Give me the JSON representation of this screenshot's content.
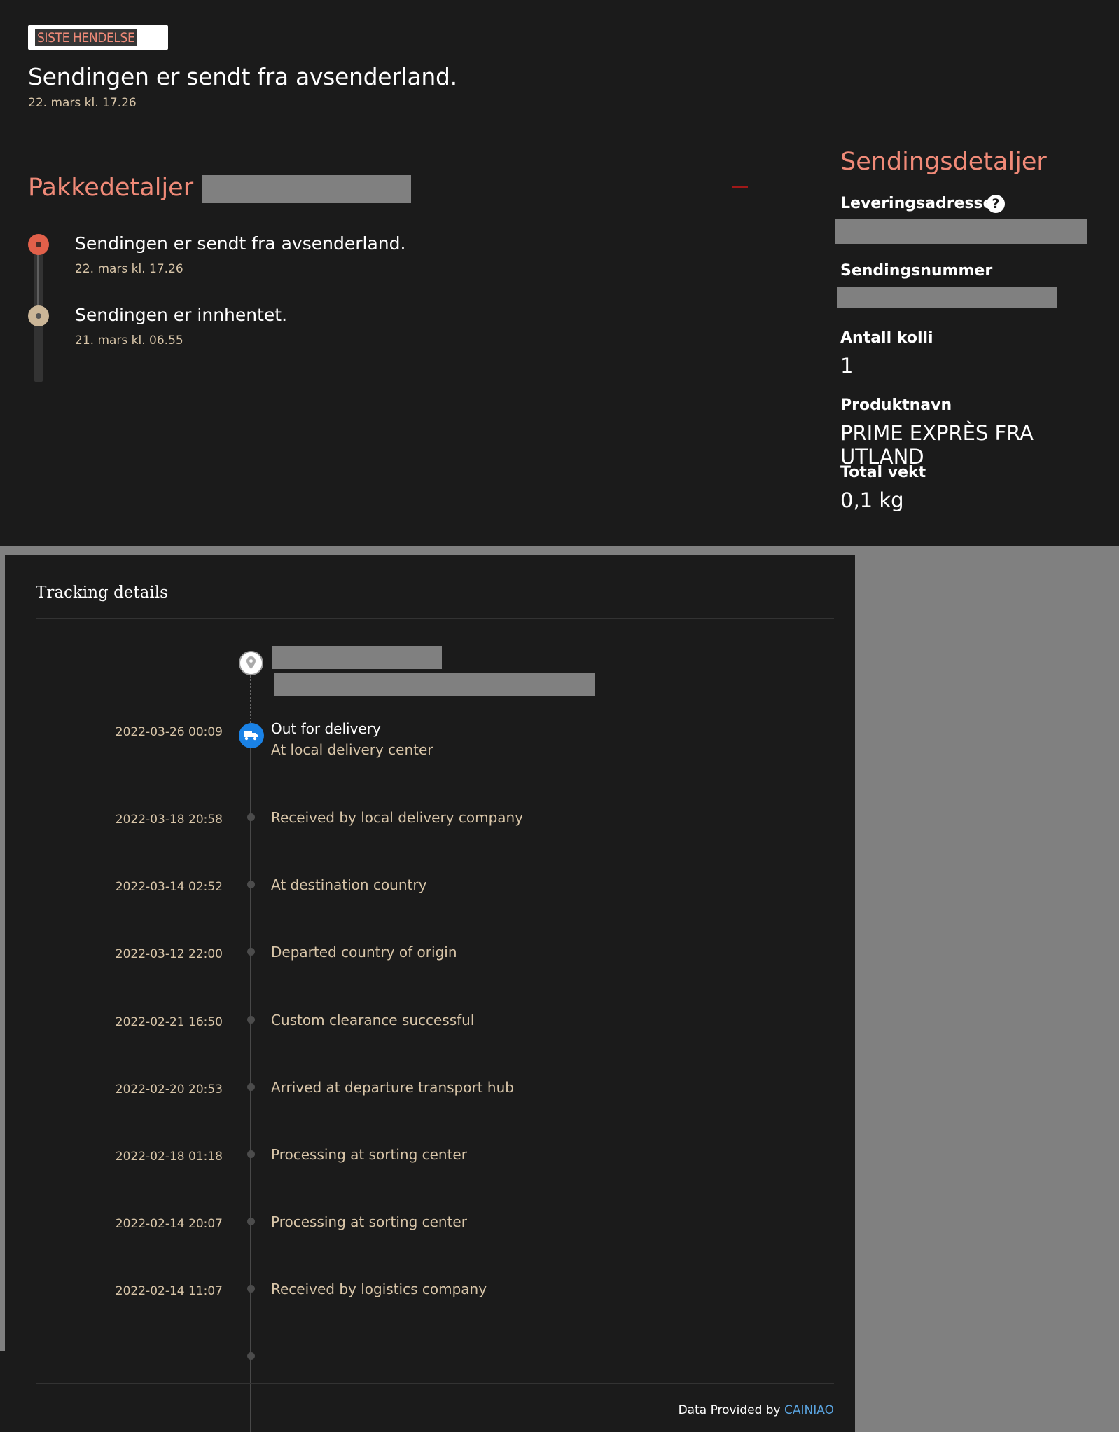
{
  "latest_event": {
    "tag": "SISTE HENDELSE",
    "title": "Sendingen er sendt fra avsenderland.",
    "date": "22. mars kl. 17.26"
  },
  "package_details": {
    "title": "Pakkedetaljer -",
    "events": [
      {
        "text": "Sendingen er sendt fra avsenderland.",
        "date": "22. mars kl. 17.26"
      },
      {
        "text": "Sendingen er innhentet.",
        "date": "21. mars kl. 06.55"
      }
    ]
  },
  "shipment_details": {
    "title": "Sendingsdetaljer",
    "delivery_address_label": "Leveringsadresse",
    "help_icon": "question-circle-icon",
    "shipment_number_label": "Sendingsnummer",
    "package_count_label": "Antall kolli",
    "package_count": "1",
    "product_name_label": "Produktnavn",
    "product_name": "PRIME EXPRÈS FRA UTLAND",
    "total_weight_label": "Total vekt",
    "total_weight": "0,1 kg"
  },
  "tracking": {
    "title": "Tracking details",
    "destination_icon": "location-pin-icon",
    "current_icon": "truck-icon",
    "current": {
      "time": "2022-03-26 00:09",
      "status": "Out for delivery",
      "detail": "At local delivery center"
    },
    "events": [
      {
        "time": "2022-03-18 20:58",
        "text": "Received by local delivery company"
      },
      {
        "time": "2022-03-14 02:52",
        "text": "At destination country"
      },
      {
        "time": "2022-03-12 22:00",
        "text": "Departed country of origin"
      },
      {
        "time": "2022-02-21 16:50",
        "text": "Custom clearance successful"
      },
      {
        "time": "2022-02-20 20:53",
        "text": "Arrived at departure transport hub"
      },
      {
        "time": "2022-02-18 01:18",
        "text": "Processing at sorting center"
      },
      {
        "time": "2022-02-14 20:07",
        "text": "Processing at sorting center"
      },
      {
        "time": "2022-02-14 11:07",
        "text": "Received by logistics company"
      }
    ],
    "footer_prefix": "Data Provided by",
    "footer_link": "CAINIAO"
  },
  "colors": {
    "background": "#1b1b1b",
    "accent": "#f08a78",
    "date_text": "#d8c5a8",
    "link": "#5aa4e0",
    "truck_badge": "#1a82e6"
  }
}
